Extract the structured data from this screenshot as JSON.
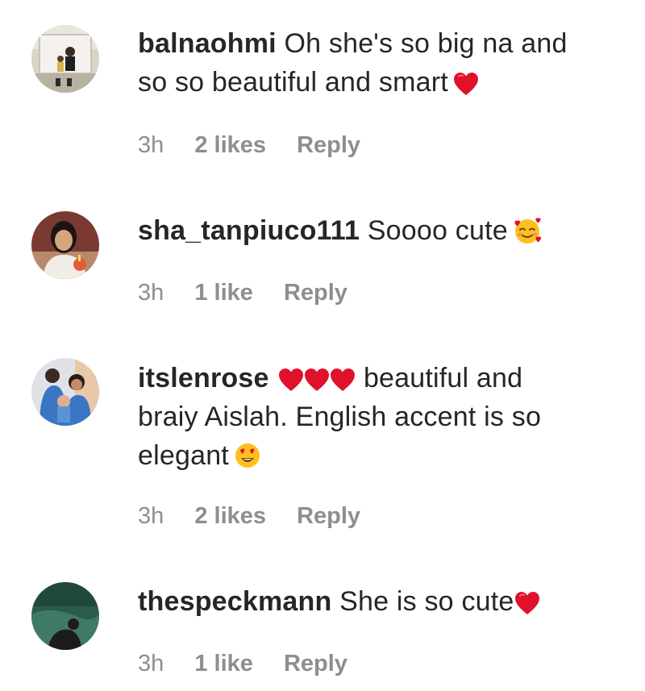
{
  "comments": [
    {
      "username": "balnaohmi",
      "text_line1": "Oh she's so big na and",
      "text_line2": "so so beautiful and smart",
      "emoji": "red-heart-icon",
      "time": "3h",
      "likes": "2 likes",
      "reply": "Reply"
    },
    {
      "username": "sha_tanpiuco111",
      "text": "Soooo cute",
      "emoji": "smiling-face-with-hearts-icon",
      "time": "3h",
      "likes": "1 like",
      "reply": "Reply"
    },
    {
      "username": "itslenrose",
      "text_line1": "beautiful and",
      "text_line2": "braiy Aislah. English accent is so",
      "text_line3": "elegant",
      "emoji_inline": "three-red-hearts-icon",
      "emoji": "heart-eyes-icon",
      "time": "3h",
      "likes": "2 likes",
      "reply": "Reply"
    },
    {
      "username": "thespeckmann",
      "text": "She is so cute",
      "emoji": "red-heart-icon",
      "time": "3h",
      "likes": "1 like",
      "reply": "Reply"
    }
  ],
  "colors": {
    "primary_text": "#262626",
    "secondary_text": "#8e8e8e",
    "heart": "#e0112b"
  }
}
